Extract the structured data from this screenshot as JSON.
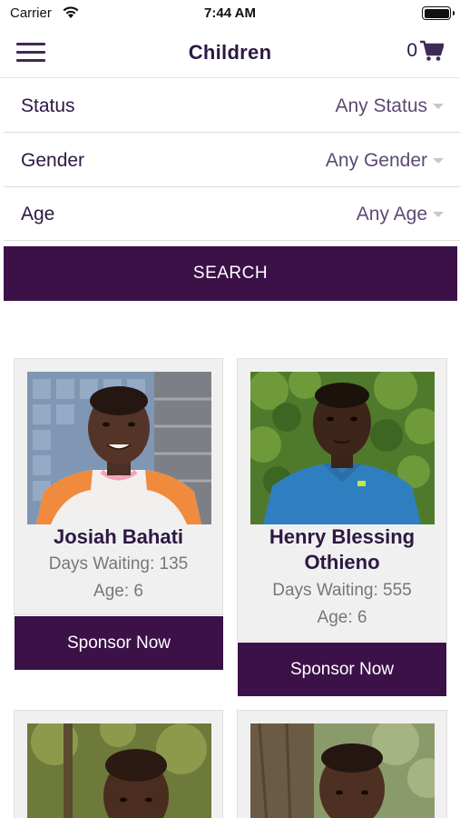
{
  "status_bar": {
    "carrier": "Carrier",
    "time": "7:44 AM"
  },
  "nav": {
    "title": "Children",
    "cart_count": "0"
  },
  "filters": [
    {
      "label": "Status",
      "value": "Any Status"
    },
    {
      "label": "Gender",
      "value": "Any Gender"
    },
    {
      "label": "Age",
      "value": "Any Age"
    }
  ],
  "search_label": "SEARCH",
  "children": [
    {
      "name": "Josiah Bahati",
      "days_waiting": "Days Waiting: 135",
      "age": "Age: 6",
      "sponsor_label": "Sponsor Now"
    },
    {
      "name": "Henry Blessing Othieno",
      "days_waiting": "Days Waiting: 555",
      "age": "Age: 6",
      "sponsor_label": "Sponsor Now"
    }
  ],
  "colors": {
    "brand": "#3b1148",
    "title": "#2d1842",
    "card_bg": "#f0f0f0"
  }
}
